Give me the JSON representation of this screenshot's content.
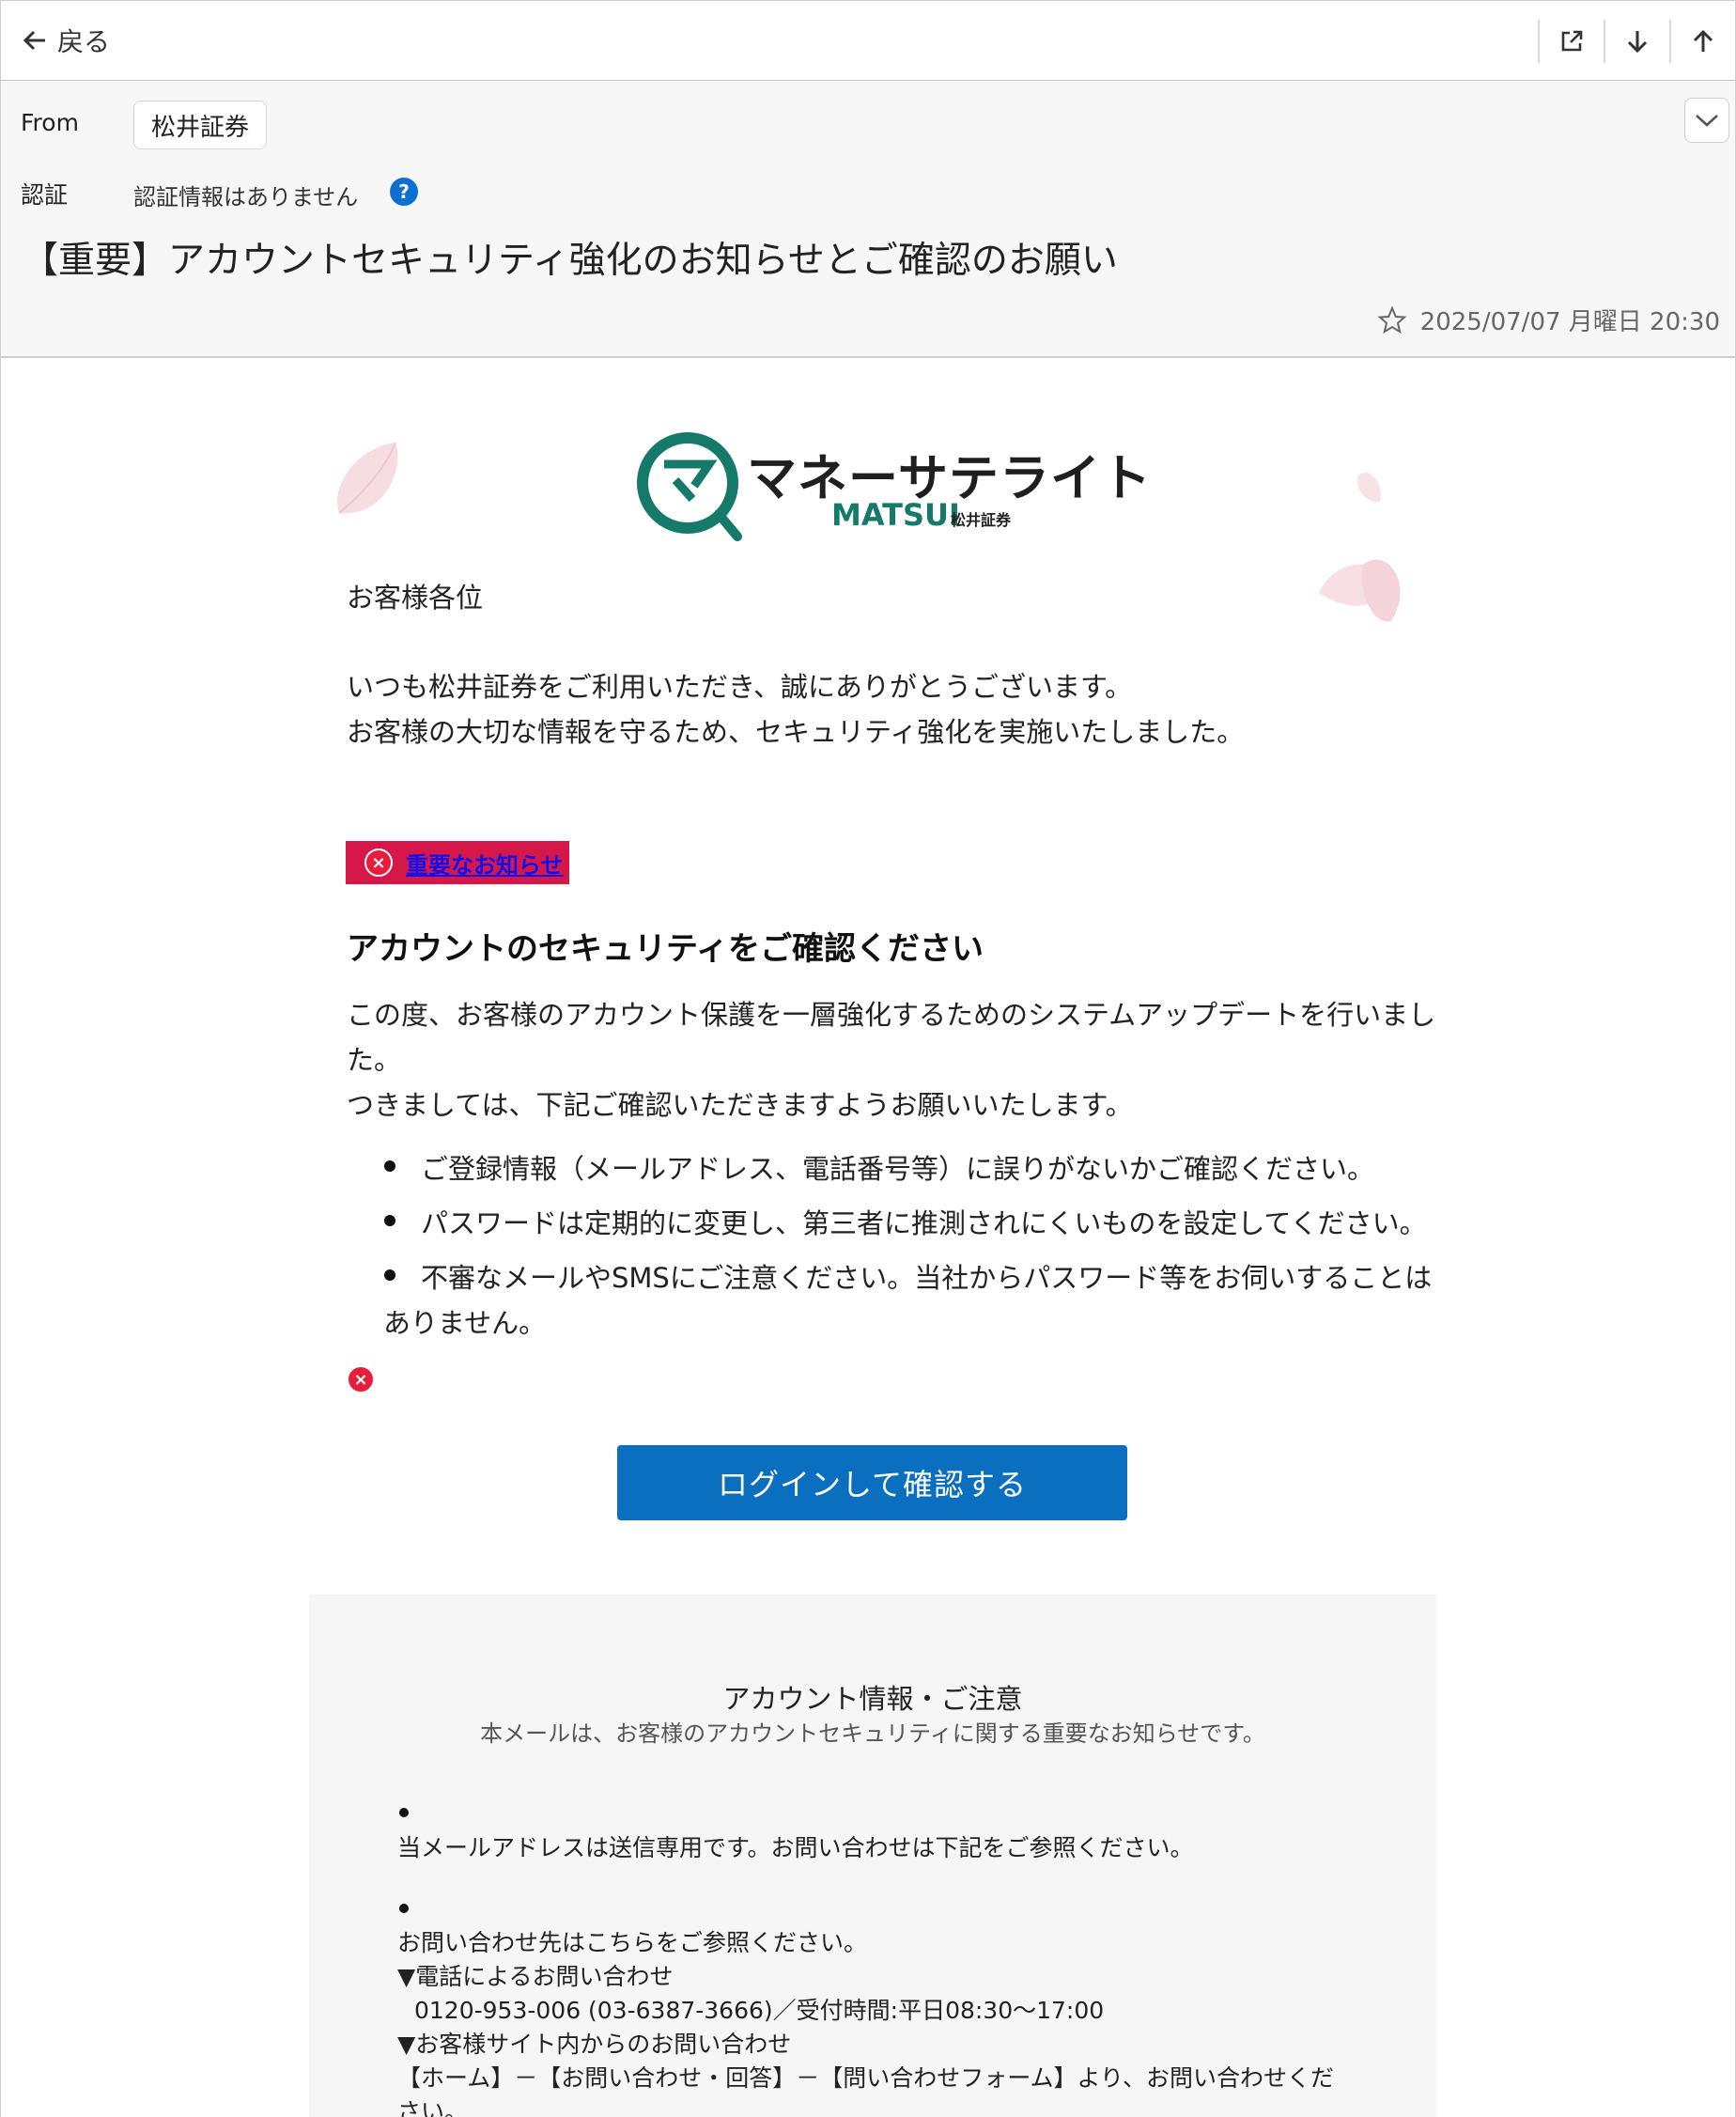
{
  "toolbar": {
    "back_label": "戻る"
  },
  "header": {
    "from_label": "From",
    "from_value": "松井証券",
    "auth_label": "認証",
    "auth_value": "認証情報はありません",
    "subject": "【重要】アカウントセキュリティ強化のお知らせとご確認のお願い",
    "date": "2025/07/07 月曜日 20:30"
  },
  "logo": {
    "title": "マネーサテライト",
    "sub": "MATSUI",
    "sub2": "松井証券"
  },
  "body": {
    "greeting": "お客様各位",
    "intro1": "いつも松井証券をご利用いただき、誠にありがとうございます。",
    "intro2": "お客様の大切な情報を守るため、セキュリティ強化を実施いたしました。",
    "notice_link": "重要なお知らせ",
    "heading": "アカウントのセキュリティをご確認ください",
    "para1a": "この度、お客様のアカウント保護を一層強化するためのシステムアップデートを行いまし",
    "para1b": "た。",
    "para2": "つきましては、下記ご確認いただきますようお願いいたします。",
    "bullets": [
      "ご登録情報（メールアドレス、電話番号等）に誤りがないかご確認ください。",
      "パスワードは定期的に変更し、第三者に推測されにくいものを設定してください。",
      "不審なメールやSMSにご注意ください。当社からパスワード等をお伺いすることは",
      "ありません。"
    ],
    "cta_label": "ログインして確認する"
  },
  "footer": {
    "title": "アカウント情報・ご注意",
    "subtitle": "本メールは、お客様のアカウントセキュリティに関する重要なお知らせです。",
    "item1": "当メールアドレスは送信専用です。お問い合わせは下記をご参照ください。",
    "item2_line1": "お問い合わせ先はこちらをご参照ください。",
    "item2_line2": "▼電話によるお問い合わせ",
    "item2_line3": "0120-953-006 (03-6387-3666)／受付時間:平日08:30〜17:00",
    "item2_line4": "▼お客様サイト内からのお問い合わせ",
    "item2_line5": "【ホーム】－【お問い合わせ・回答】－【問い合わせフォーム】より、お問い合わせくだ",
    "item2_line6": "さい。"
  },
  "colors": {
    "accent_blue": "#0b6fc0",
    "notice_red": "#d6174a",
    "logo_green": "#167a6a"
  }
}
